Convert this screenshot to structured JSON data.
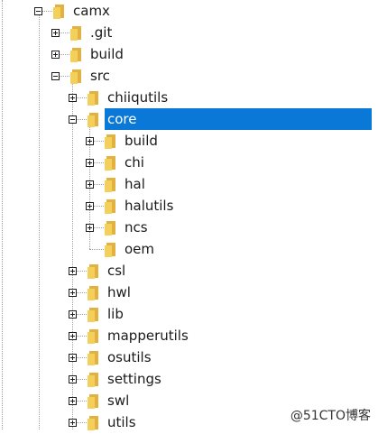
{
  "colors": {
    "selection": "#0a78d7",
    "folder_front": "#f3cf5b",
    "folder_back": "#e2b13f",
    "connector": "#a0a0a0"
  },
  "icons": {
    "folder": "folder-icon",
    "expand": "expand-plus-icon",
    "collapse": "collapse-minus-icon"
  },
  "tree": [
    {
      "label": "camx",
      "depth": 0,
      "state": "expanded"
    },
    {
      "label": ".git",
      "depth": 1,
      "state": "collapsed"
    },
    {
      "label": "build",
      "depth": 1,
      "state": "collapsed"
    },
    {
      "label": "src",
      "depth": 1,
      "state": "expanded"
    },
    {
      "label": "chiiqutils",
      "depth": 2,
      "state": "collapsed"
    },
    {
      "label": "core",
      "depth": 2,
      "state": "expanded",
      "selected": true
    },
    {
      "label": "build",
      "depth": 3,
      "state": "collapsed"
    },
    {
      "label": "chi",
      "depth": 3,
      "state": "collapsed"
    },
    {
      "label": "hal",
      "depth": 3,
      "state": "collapsed"
    },
    {
      "label": "halutils",
      "depth": 3,
      "state": "collapsed"
    },
    {
      "label": "ncs",
      "depth": 3,
      "state": "collapsed"
    },
    {
      "label": "oem",
      "depth": 3,
      "state": "leaf"
    },
    {
      "label": "csl",
      "depth": 2,
      "state": "collapsed"
    },
    {
      "label": "hwl",
      "depth": 2,
      "state": "collapsed"
    },
    {
      "label": "lib",
      "depth": 2,
      "state": "collapsed"
    },
    {
      "label": "mapperutils",
      "depth": 2,
      "state": "collapsed"
    },
    {
      "label": "osutils",
      "depth": 2,
      "state": "collapsed"
    },
    {
      "label": "settings",
      "depth": 2,
      "state": "collapsed"
    },
    {
      "label": "swl",
      "depth": 2,
      "state": "collapsed"
    },
    {
      "label": "utils",
      "depth": 2,
      "state": "collapsed"
    }
  ],
  "watermark": "@51CTO博客"
}
